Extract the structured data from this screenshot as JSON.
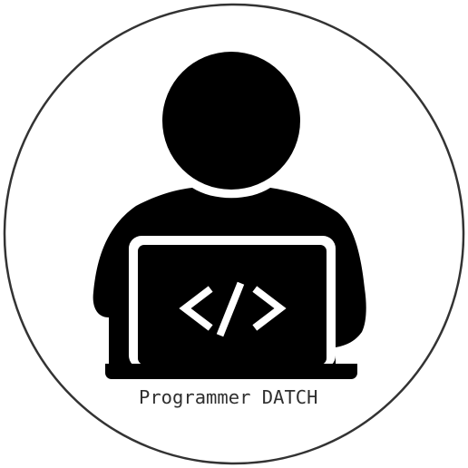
{
  "badge": {
    "caption": "Programmer DATCH",
    "icon": "programmer-at-laptop-icon",
    "code_glyph": "code-brackets-icon"
  },
  "colors": {
    "background": "#ffffff",
    "border": "#333333",
    "figure": "#000000",
    "caption_text": "#2f2f2f"
  }
}
